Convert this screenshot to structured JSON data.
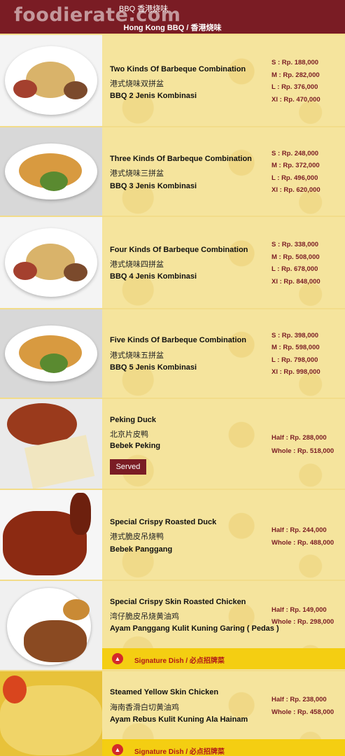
{
  "header": {
    "watermark": "foodierate.com",
    "top_label": "BBQ 香港烧味",
    "title": "Hong Kong BBQ / 香港烧味"
  },
  "items": [
    {
      "name": "Two Kinds Of Barbeque Combination",
      "cn": "港式烧味双拼盆",
      "id": "BBQ 2 Jenis Kombinasi",
      "prices": [
        "S : Rp. 188,000",
        "M : Rp. 282,000",
        "L : Rp. 376,000",
        "Xl : Rp. 470,000"
      ]
    },
    {
      "name": "Three Kinds Of Barbeque Combination",
      "cn": "港式烧味三拼盆",
      "id": "BBQ 3 Jenis Kombinasi",
      "prices": [
        "S : Rp. 248,000",
        "M : Rp. 372,000",
        "L : Rp. 496,000",
        "Xl : Rp. 620,000"
      ]
    },
    {
      "name": "Four Kinds Of Barbeque Combination",
      "cn": "港式烧味四拼盆",
      "id": "BBQ 4 Jenis Kombinasi",
      "prices": [
        "S : Rp. 338,000",
        "M : Rp. 508,000",
        "L : Rp. 678,000",
        "Xl : Rp. 848,000"
      ]
    },
    {
      "name": "Five Kinds Of Barbeque Combination",
      "cn": "港式烧味五拼盆",
      "id": "BBQ 5 Jenis Kombinasi",
      "prices": [
        "S : Rp. 398,000",
        "M : Rp. 598,000",
        "L : Rp. 798,000",
        "Xl : Rp. 998,000"
      ]
    },
    {
      "name": "Peking Duck",
      "cn": "北京片皮鸭",
      "id": "Bebek Peking",
      "served": "Served",
      "prices": [
        "Half : Rp. 288,000",
        "Whole : Rp. 518,000"
      ]
    },
    {
      "name": "Special Crispy Roasted Duck",
      "cn": "港式脆皮吊烧鸭",
      "id": "Bebek Panggang",
      "prices": [
        "Half : Rp. 244,000",
        "Whole : Rp. 488,000"
      ]
    },
    {
      "name": "Special Crispy Skin Roasted Chicken",
      "cn": "湾仔脆皮吊烧黄油鸡",
      "id": "Ayam Panggang Kulit Kuning Garing ( Pedas )",
      "prices": [
        "Half : Rp. 149,000",
        "Whole : Rp. 298,000"
      ],
      "signature": "Signature Dish / 必点招牌菜"
    },
    {
      "name": "Steamed Yellow Skin Chicken",
      "cn": "海南香滑白切黄油鸡",
      "id": "Ayam Rebus Kulit Kuning Ala Hainam",
      "prices": [
        "Half : Rp. 238,000",
        "Whole : Rp. 458,000"
      ],
      "signature": "Signature Dish / 必点招牌菜"
    }
  ],
  "colors": {
    "header": "#7a1c24",
    "price": "#7a1c24",
    "signature_bar": "#f4ce12",
    "background": "#f5e49d"
  }
}
